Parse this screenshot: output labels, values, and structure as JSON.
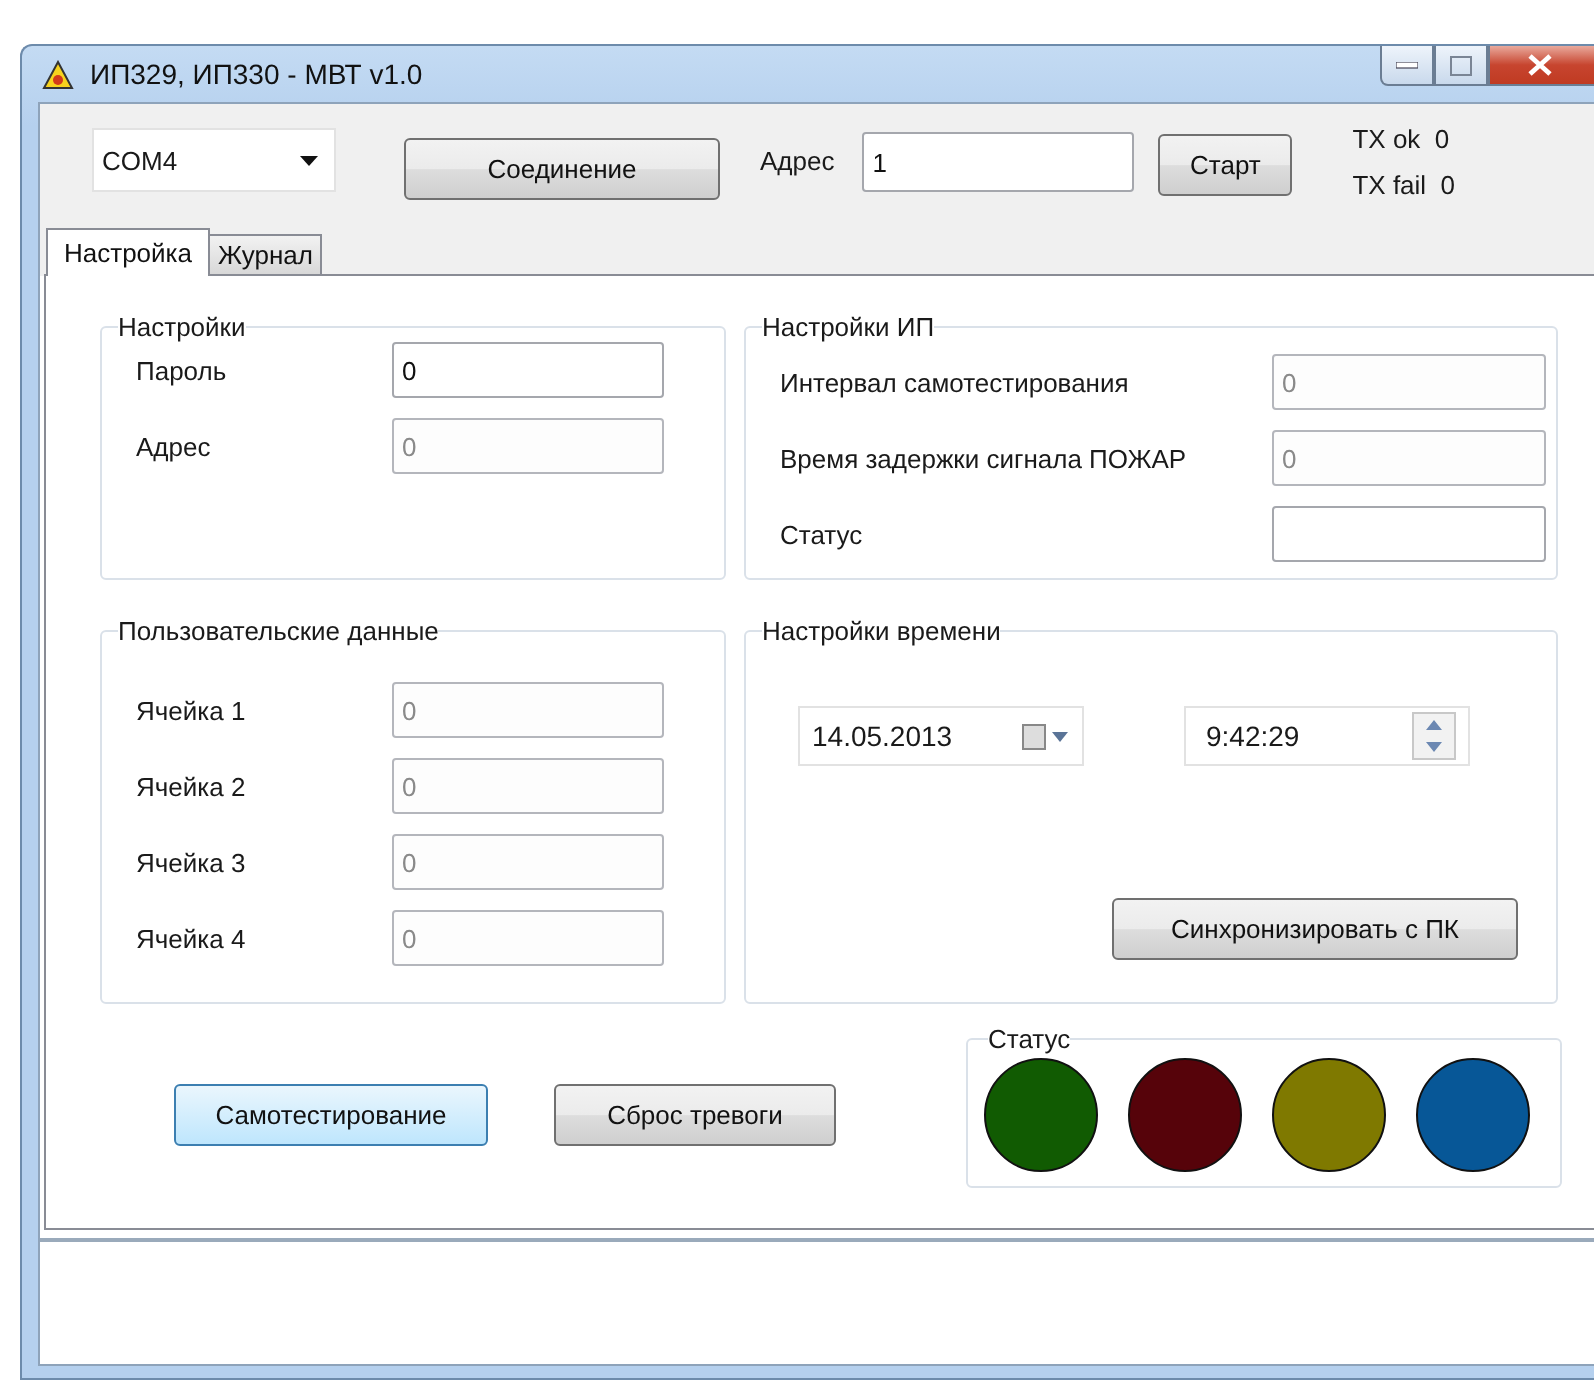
{
  "window": {
    "title": "ИП329, ИП330 - МВТ v1.0"
  },
  "toolbar": {
    "port": "COM4",
    "connect_button": "Соединение",
    "address_label": "Адрес",
    "address_value": "1",
    "start_button": "Старт",
    "counters": [
      {
        "label": "TX ok",
        "value": "0"
      },
      {
        "label": "TX fail",
        "value": "0"
      }
    ]
  },
  "tabs": [
    {
      "label": "Настройка",
      "selected": true
    },
    {
      "label": "Журнал",
      "selected": false
    }
  ],
  "groups": [
    {
      "title": "Настройки",
      "fields": [
        {
          "label": "Пароль",
          "value": "0",
          "disabled": false
        },
        {
          "label": "Адрес",
          "value": "0",
          "disabled": true
        }
      ]
    },
    {
      "title": "Настройки ИП",
      "fields": [
        {
          "label": "Интервал самотестирования",
          "value": "0",
          "disabled": true
        },
        {
          "label": "Время задержки сигнала ПОЖАР",
          "value": "0",
          "disabled": true
        },
        {
          "label": "Статус",
          "disabled": false
        }
      ]
    },
    {
      "title": "Пользовательские данные",
      "fields": [
        {
          "label": "Ячейка 1",
          "value": "0",
          "disabled": true
        },
        {
          "label": "Ячейка 2",
          "value": "0",
          "disabled": true
        },
        {
          "label": "Ячейка 3",
          "value": "0",
          "disabled": true
        },
        {
          "label": "Ячейка 4",
          "value": "0",
          "disabled": true
        }
      ]
    }
  ],
  "time_settings": {
    "title": "Настройки времени",
    "date": "14.05.2013",
    "time": "9:42:29",
    "sync_button": "Синхронизировать с ПК"
  },
  "actions": [
    {
      "label": "Самотестирование",
      "focused": true
    },
    {
      "label": "Сброс тревоги",
      "focused": false
    }
  ],
  "status": {
    "title": "Статус",
    "lights": [
      {
        "color": "#115b02"
      },
      {
        "color": "#56030a"
      },
      {
        "color": "#7f7900"
      },
      {
        "color": "#075797"
      }
    ]
  }
}
